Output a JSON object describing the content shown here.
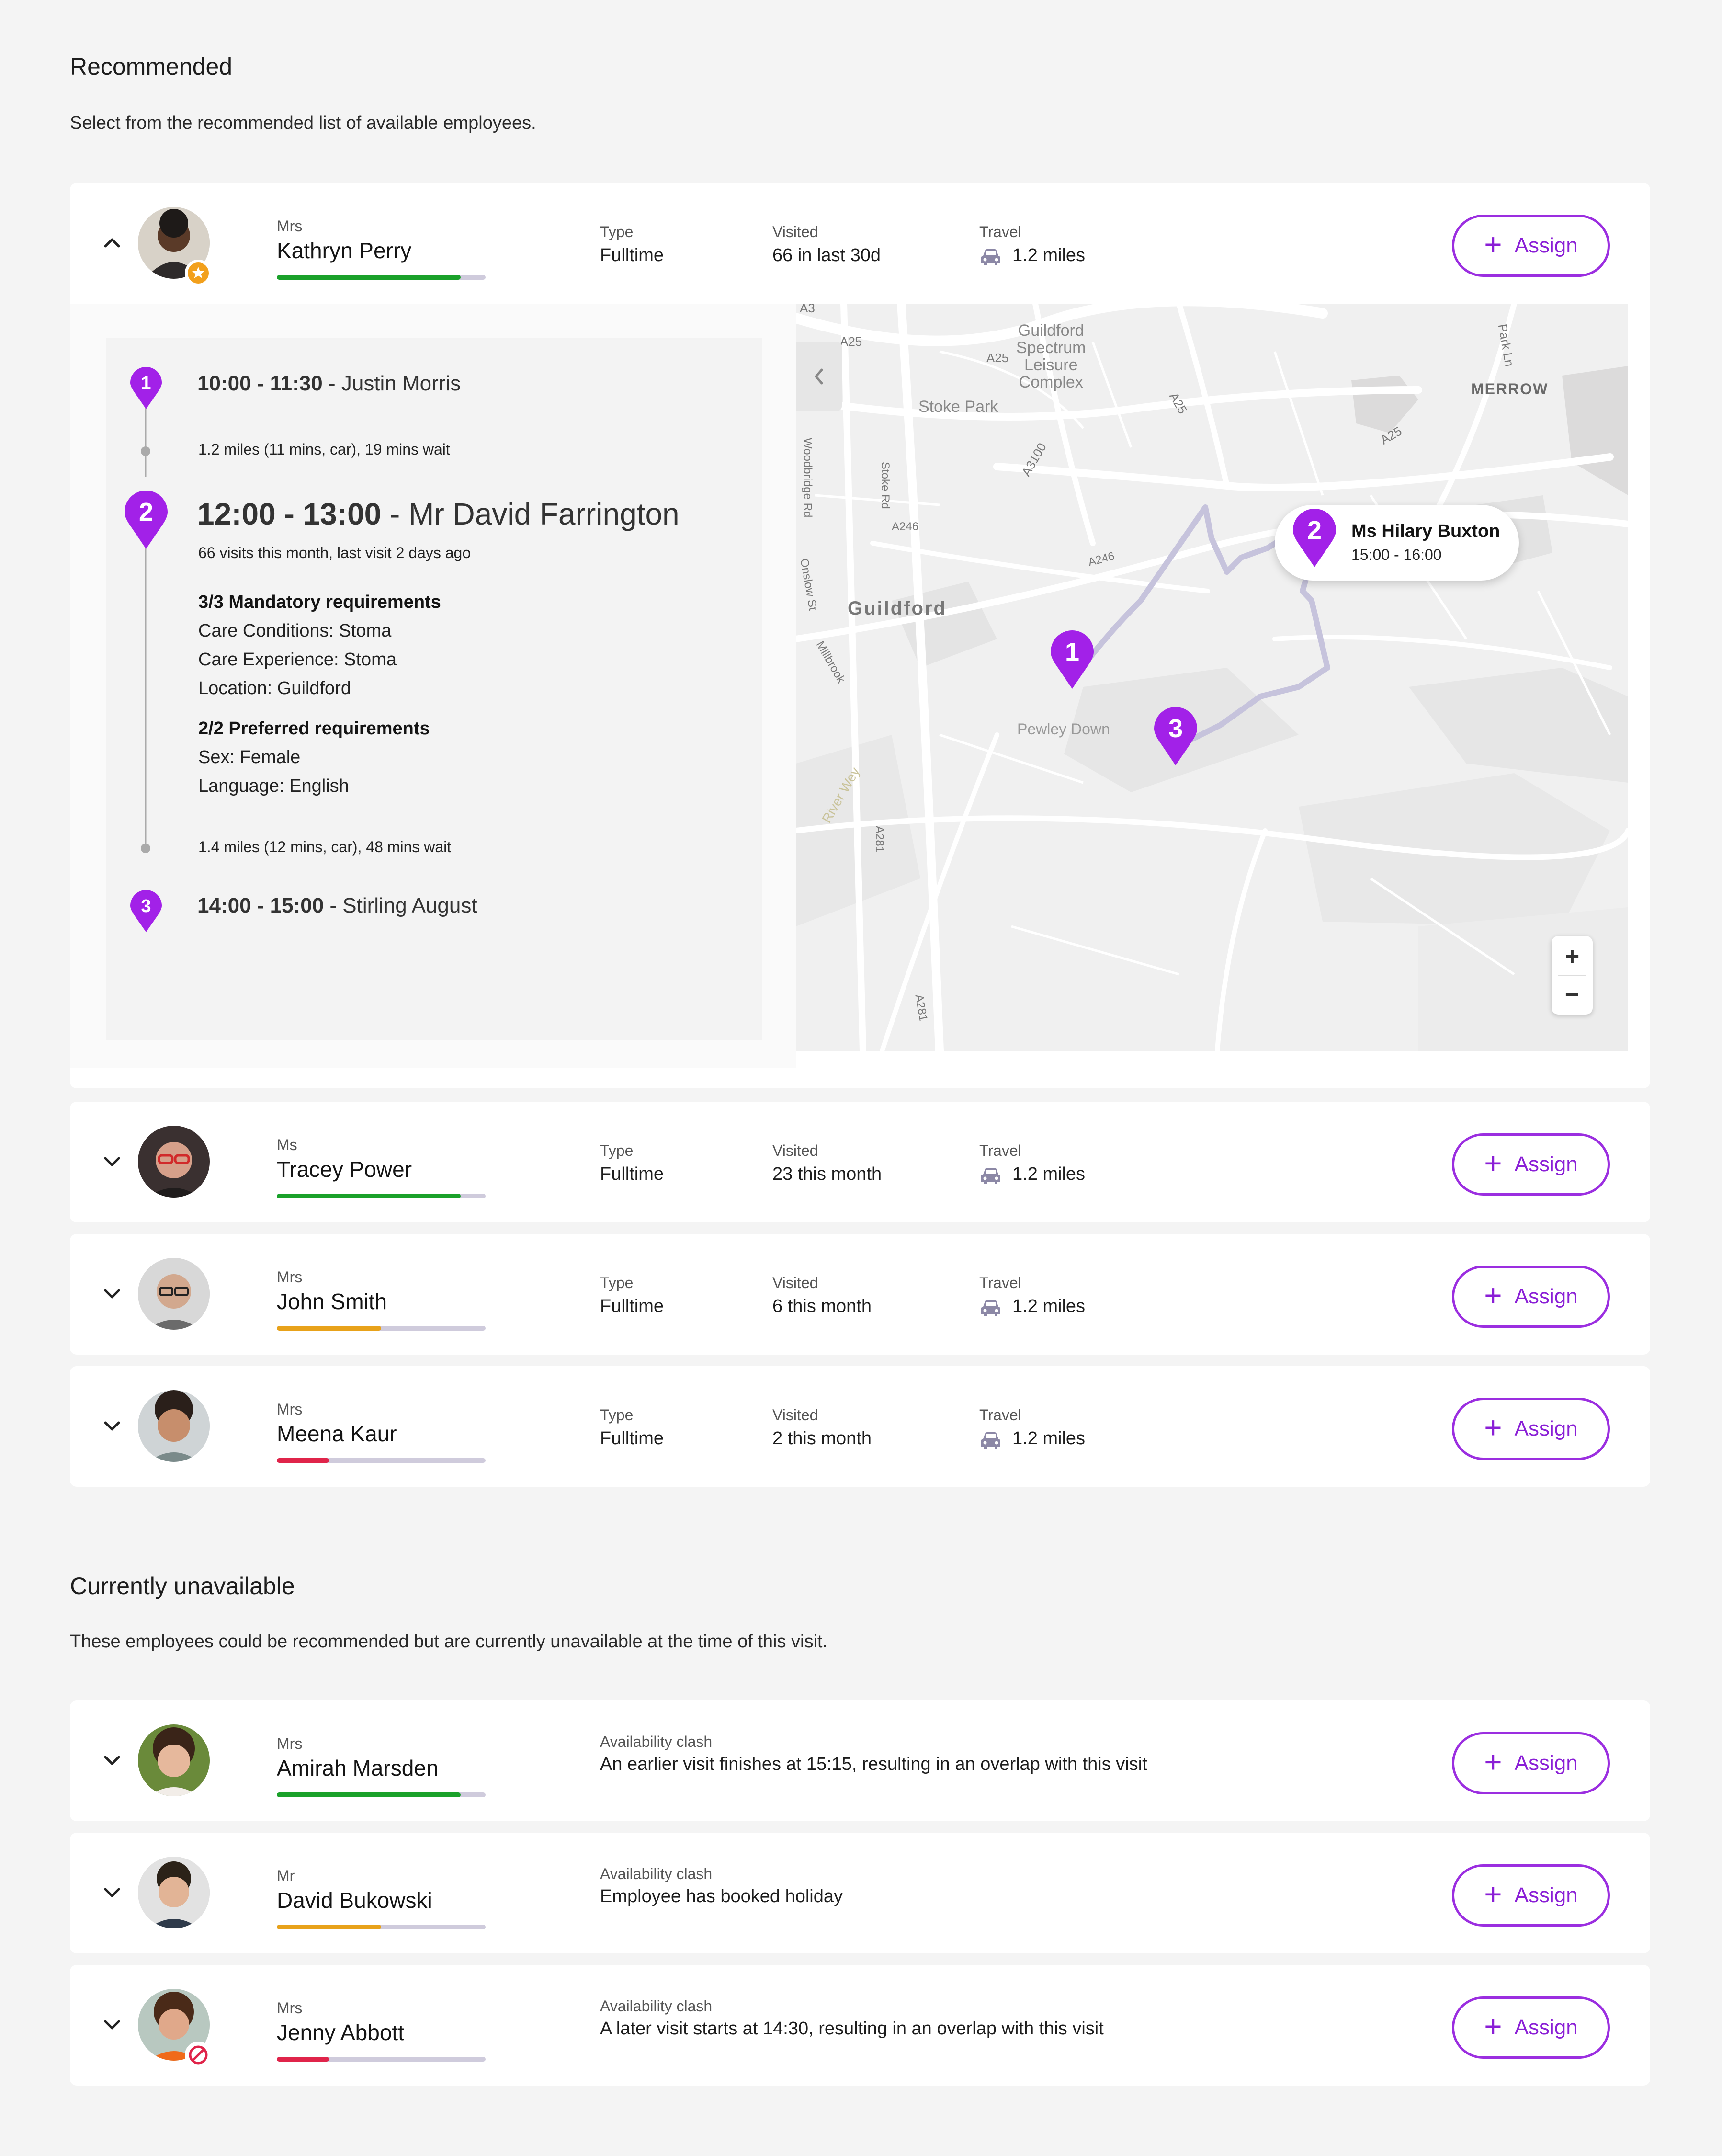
{
  "recommended": {
    "title": "Recommended",
    "subtitle": "Select from the recommended list of available employees."
  },
  "unavailable": {
    "title": "Currently unavailable",
    "subtitle": "These employees could be recommended but are currently unavailable at the time of this visit."
  },
  "labels": {
    "type": "Type",
    "visited": "Visited",
    "travel": "Travel",
    "availability_clash": "Availability clash",
    "assign": "Assign",
    "plus": "+"
  },
  "colors": {
    "accent": "#9b2ee0",
    "good": "#1aa12a",
    "medium": "#e8a21a",
    "low": "#e0244a"
  },
  "employees": [
    {
      "title": "Mrs",
      "name": "Kathryn Perry",
      "type": "Fulltime",
      "visited": "66 in last 30d",
      "travel": "1.2 miles",
      "score": 0.88,
      "rating": "good",
      "badge": "star-badge-icon",
      "expanded": true
    },
    {
      "title": "Ms",
      "name": "Tracey Power",
      "type": "Fulltime",
      "visited": "23 this month",
      "travel": "1.2 miles",
      "score": 0.88,
      "rating": "good"
    },
    {
      "title": "Mrs",
      "name": "John Smith",
      "type": "Fulltime",
      "visited": "6 this month",
      "travel": "1.2 miles",
      "score": 0.5,
      "rating": "medium"
    },
    {
      "title": "Mrs",
      "name": "Meena Kaur",
      "type": "Fulltime",
      "visited": "2 this month",
      "travel": "1.2 miles",
      "score": 0.25,
      "rating": "low"
    }
  ],
  "unavailable_employees": [
    {
      "title": "Mrs",
      "name": "Amirah Marsden",
      "clash": "An earlier visit finishes at 15:15, resulting in an overlap with this visit",
      "score": 0.88,
      "rating": "good"
    },
    {
      "title": "Mr",
      "name": "David Bukowski",
      "clash": "Employee has booked holiday",
      "score": 0.5,
      "rating": "medium"
    },
    {
      "title": "Mrs",
      "name": "Jenny Abbott",
      "clash": "A later visit starts at 14:30, resulting in an overlap with this visit",
      "score": 0.25,
      "rating": "low",
      "badge": "blocked-badge-icon"
    }
  ],
  "timeline": {
    "stop1": {
      "num": "1",
      "time": "10:00 - 11:30",
      "sep": " - ",
      "client": "Justin Morris"
    },
    "leg1": "1.2 miles (11 mins, car), 19 mins wait",
    "stop2": {
      "num": "2",
      "time": "12:00 - 13:00",
      "sep": " - ",
      "client": "Mr David Farrington",
      "meta": "66 visits this month, last visit 2 days ago"
    },
    "mandatory": {
      "heading": "3/3 Mandatory requirements",
      "items": [
        "Care Conditions: Stoma",
        "Care Experience: Stoma",
        "Location: Guildford"
      ]
    },
    "preferred": {
      "heading": "2/2 Preferred requirements",
      "items": [
        "Sex: Female",
        "Language: English"
      ]
    },
    "leg2": "1.4 miles (12 mins, car), 48 mins wait",
    "stop3": {
      "num": "3",
      "time": "14:00 - 15:00",
      "sep": " - ",
      "client": "Stirling August"
    }
  },
  "map": {
    "labels": {
      "a3": "A3",
      "a25_1": "A25",
      "a25_2": "A25",
      "a25_3": "A25",
      "a25_4": "A25",
      "guildford_spectrum": [
        "Guildford",
        "Spectrum",
        "Leisure",
        "Complex"
      ],
      "park_ln": "Park Ln",
      "merrow": "MERROW",
      "stoke_park": "Stoke Park",
      "a3100": "A3100",
      "woodbridge": "Woodbridge Rd",
      "stoke_rd": "Stoke Rd",
      "a246_1": "A246",
      "a246_2": "A246",
      "onslow": "Onslow St",
      "guildford": "Guildford",
      "millbrook": "Millbrook",
      "pewley": "Pewley Down",
      "river_wey": "River Wey",
      "a281_1": "A281",
      "a281_2": "A281"
    },
    "popup": {
      "num": "2",
      "name": "Ms Hilary Buxton",
      "time": "15:00 - 16:00"
    },
    "pins": [
      "1",
      "2",
      "3"
    ],
    "zoom_in": "+",
    "zoom_out": "−",
    "collapse_icon": "chevron-left-icon"
  }
}
